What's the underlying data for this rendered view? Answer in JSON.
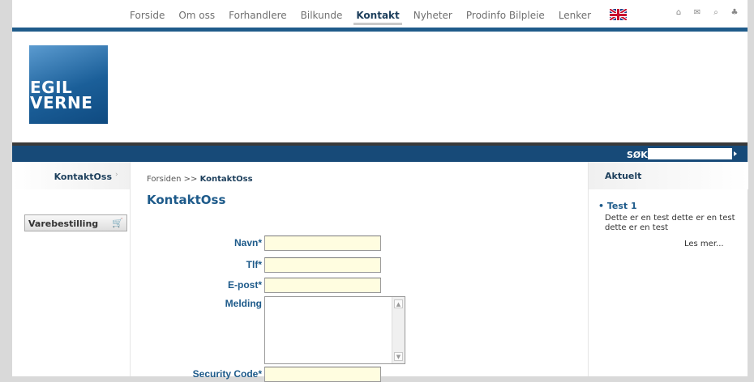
{
  "nav": {
    "items": [
      {
        "label": "Forside",
        "active": false
      },
      {
        "label": "Om oss",
        "active": false
      },
      {
        "label": "Forhandlere",
        "active": false
      },
      {
        "label": "Bilkunde",
        "active": false
      },
      {
        "label": "Kontakt",
        "active": true
      },
      {
        "label": "Nyheter",
        "active": false
      },
      {
        "label": "Prodinfo Bilpleie",
        "active": false
      },
      {
        "label": "Lenker",
        "active": false
      }
    ],
    "language_icon": "uk-flag-icon",
    "tools": [
      "home-icon",
      "mail-icon",
      "search-icon",
      "sitemap-icon"
    ]
  },
  "logo": {
    "line1": "EGIL",
    "line2": "VERNE"
  },
  "search": {
    "label": "SØK",
    "value": ""
  },
  "leftnav": {
    "label": "KontaktOss"
  },
  "varebestilling": {
    "label": "Varebestilling"
  },
  "breadcrumb": {
    "home": "Forsiden",
    "separator": ">>",
    "current": "KontaktOss"
  },
  "page": {
    "title": "KontaktOss"
  },
  "form": {
    "navn": "Navn*",
    "tlf": "Tlf*",
    "epost": "E-post*",
    "melding": "Melding",
    "security": "Security Code*"
  },
  "aktuelt": {
    "heading": "Aktuelt",
    "title": "Test 1",
    "body": "Dette er en test dette er en test dette er en test",
    "more": "Les mer..."
  },
  "colors": {
    "brand_blue": "#1d5a8a",
    "bar_blue": "#174a78",
    "input_bg": "#fffde0"
  }
}
